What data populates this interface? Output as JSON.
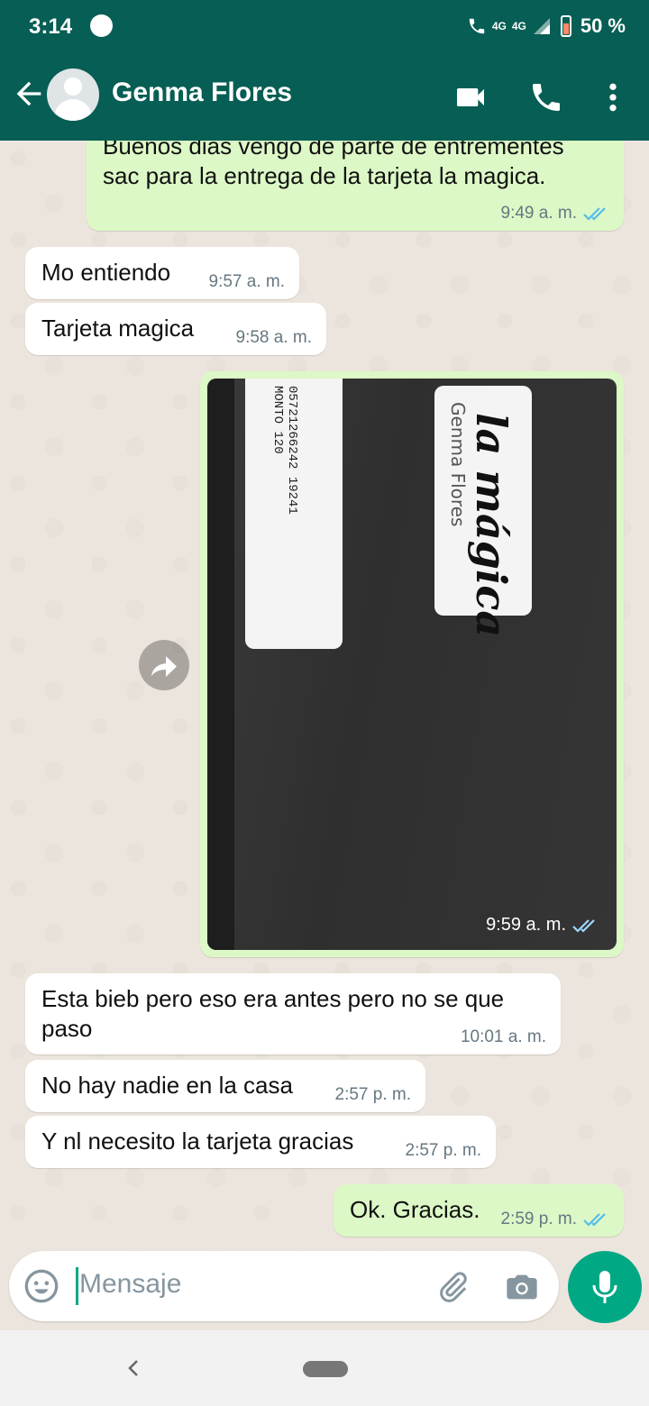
{
  "status_bar": {
    "time": "3:14",
    "network_small": "4G",
    "network": "4G",
    "battery": "50 %"
  },
  "header": {
    "contact_name": "Genma Flores"
  },
  "messages": [
    {
      "direction": "out",
      "text": "Buenos dias vengo de parte de entrementes\nsac para la entrega de la tarjeta la magica.",
      "time": "9:49 a. m."
    },
    {
      "direction": "in",
      "text": "Mo entiendo",
      "time": "9:57 a. m."
    },
    {
      "direction": "in",
      "text": "Tarjeta magica",
      "time": "9:58 a. m."
    },
    {
      "direction": "out",
      "type": "image",
      "time": "9:59 a. m.",
      "image_text": {
        "label_left": "05721266242 19241\nMONTO 120",
        "brand": "la mágica",
        "handwritten": "Genma Flores"
      }
    },
    {
      "direction": "in",
      "text": "Esta bieb pero eso era antes pero no se que\npaso",
      "time": "10:01 a. m."
    },
    {
      "direction": "in",
      "text": "No hay nadie en la casa",
      "time": "2:57 p. m."
    },
    {
      "direction": "in",
      "text": "Y nl necesito la tarjeta gracias",
      "time": "2:57 p. m."
    },
    {
      "direction": "out",
      "text": "Ok. Gracias.",
      "time": "2:59 p. m."
    }
  ],
  "composer": {
    "placeholder": "Mensaje"
  },
  "icons": {
    "back": "arrow-left-icon",
    "video": "video-call-icon",
    "call": "phone-icon",
    "menu": "more-vert-icon",
    "read": "double-check-icon",
    "emoji": "emoji-icon",
    "attach": "paperclip-icon",
    "camera": "camera-icon",
    "mic": "microphone-icon",
    "forward": "forward-icon"
  },
  "colors": {
    "header": "#075e54",
    "outgoing": "#dcf8c6",
    "incoming": "#ffffff",
    "accent": "#00a884",
    "read_ticks": "#53bdeb"
  }
}
